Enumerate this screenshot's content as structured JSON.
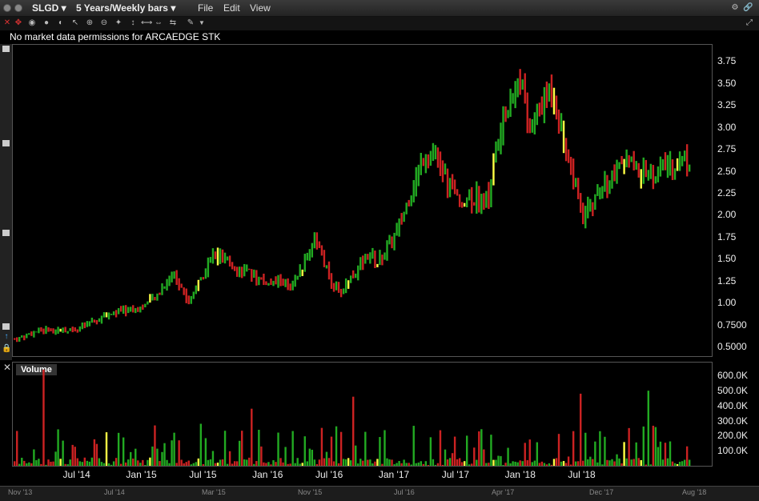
{
  "window": {
    "symbol": "SLGD",
    "period": "5 Years/Weekly bars",
    "menu": [
      "File",
      "Edit",
      "View"
    ]
  },
  "notice": "No market data permissions for ARCAEDGE STK",
  "volume_panel": {
    "label": "Volume"
  },
  "chart_data": [
    {
      "type": "bar",
      "subtype": "ohlc-weekly",
      "y_ticks": [
        "3.75",
        "3.50",
        "3.25",
        "3.00",
        "2.75",
        "2.50",
        "2.25",
        "2.00",
        "1.75",
        "1.50",
        "1.25",
        "1.00",
        "0.7500",
        "0.5000"
      ],
      "x_ticks": [
        "Jul '14",
        "Jan '15",
        "Jul '15",
        "Jan '16",
        "Jul '16",
        "Jan '17",
        "Jul '17",
        "Jan '18",
        "Jul '18"
      ],
      "ylim": [
        0.4,
        3.9
      ],
      "colors": {
        "up": "#22aa22",
        "down": "#cc2222",
        "neutral": "#ffff44"
      },
      "series_anchor_weeks": [
        0,
        10,
        26,
        40,
        52,
        58,
        66,
        72,
        82,
        92,
        106,
        110,
        114,
        118,
        120,
        124,
        130,
        134,
        146,
        150,
        158,
        170,
        176,
        184,
        186,
        196,
        198,
        204,
        210,
        212,
        222,
        235,
        238,
        252,
        262,
        272,
        280
      ],
      "series_anchor_close": [
        0.58,
        0.68,
        0.7,
        0.88,
        0.95,
        1.05,
        1.35,
        1.0,
        1.55,
        1.4,
        1.2,
        1.25,
        1.15,
        1.35,
        1.45,
        1.75,
        1.3,
        1.1,
        1.55,
        1.45,
        1.8,
        2.75,
        2.55,
        2.1,
        2.2,
        2.2,
        2.6,
        3.3,
        3.6,
        2.95,
        3.45,
        1.95,
        2.1,
        2.6,
        2.45,
        2.6,
        2.65
      ]
    },
    {
      "type": "bar",
      "subtype": "volume",
      "y_ticks": [
        "600.0K",
        "500.0K",
        "400.0K",
        "300.0K",
        "200.0K",
        "100.0K"
      ],
      "ylim": [
        0,
        650000
      ],
      "spikes_week": [
        12,
        98,
        140,
        172,
        234,
        262
      ],
      "spikes_value": [
        640000,
        380000,
        460000,
        190000,
        480000,
        500000
      ]
    }
  ],
  "navigator": {
    "labels": [
      "Nov '13",
      "Jul '14",
      "Mar '15",
      "Nov '15",
      "Jul '16",
      "Apr '17",
      "Dec '17",
      "Aug '18"
    ]
  }
}
